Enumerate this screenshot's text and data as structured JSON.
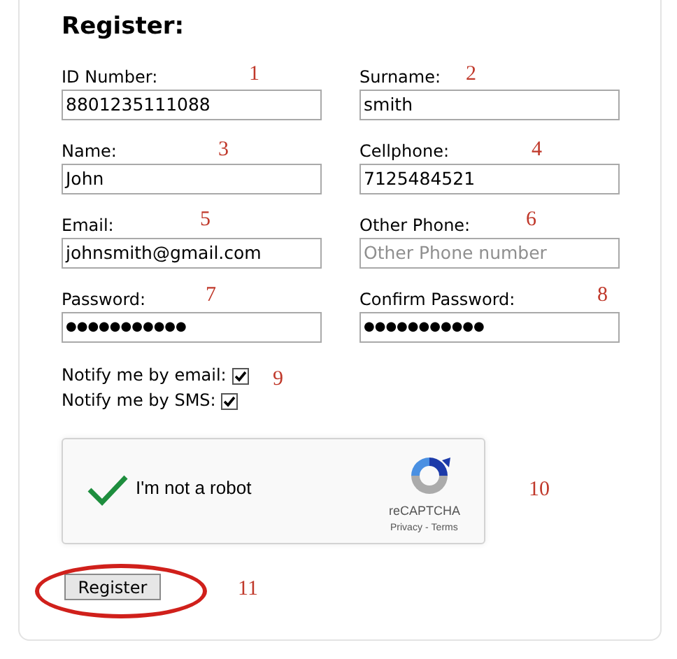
{
  "title": "Register:",
  "fields": [
    {
      "label": "ID Number:",
      "value": "8801235111088",
      "marker": "1"
    },
    {
      "label": "Surname:",
      "value": "smith",
      "marker": "2"
    },
    {
      "label": "Name:",
      "value": "John",
      "marker": "3"
    },
    {
      "label": "Cellphone:",
      "value": "7125484521",
      "marker": "4"
    },
    {
      "label": "Email:",
      "value": "johnsmith@gmail.com",
      "marker": "5"
    },
    {
      "label": "Other Phone:",
      "placeholder": "Other Phone number",
      "marker": "6"
    },
    {
      "label": "Password:",
      "value": "●●●●●●●●●●●",
      "marker": "7",
      "kind": "password"
    },
    {
      "label": "Confirm Password:",
      "value": "●●●●●●●●●●●",
      "marker": "8",
      "kind": "password"
    }
  ],
  "notifications": [
    {
      "label": "Notify me by email:",
      "checked": true
    },
    {
      "label": "Notify me by SMS:",
      "checked": true
    }
  ],
  "notifications_marker": "9",
  "captcha": {
    "label": "I'm not a robot",
    "checked": true,
    "brand": "reCAPTCHA",
    "links": [
      "Privacy",
      "Terms"
    ],
    "separator": "-",
    "marker": "10"
  },
  "submit": {
    "label": "Register",
    "circled": true,
    "marker": "11"
  }
}
